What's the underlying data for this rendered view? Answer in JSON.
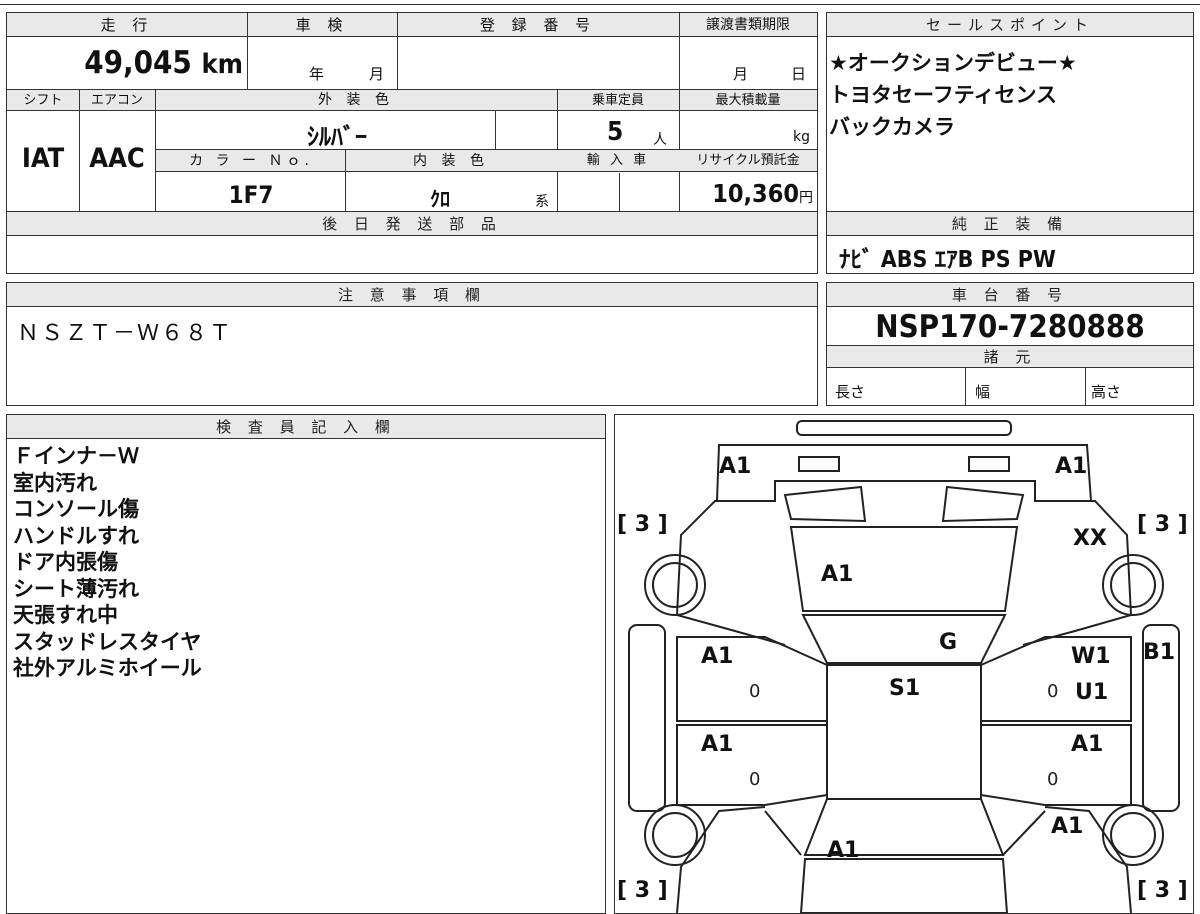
{
  "top_info": {
    "mileage_label": "走 行",
    "mileage_value": "49,045",
    "mileage_unit": "km",
    "shaken_label": "車 検",
    "shaken_year": "年",
    "shaken_month": "月",
    "reg_label": "登 録 番 号",
    "deadline_label": "譲渡書類期限",
    "deadline_month": "月",
    "deadline_day": "日",
    "shift_label": "シフト",
    "shift_value": "IAT",
    "ac_label": "エアコン",
    "ac_value": "AAC",
    "ext_color_label": "外 装 色",
    "ext_color_value": "ｼﾙﾊﾞｰ",
    "capacity_label": "乗車定員",
    "capacity_value": "5",
    "capacity_unit": "人",
    "maxload_label": "最大積載量",
    "maxload_unit": "kg",
    "colorno_label": "カ ラ ー Ｎｏ.",
    "colorno_value": "1F7",
    "int_color_label": "内 装 色",
    "int_color_value": "ｸﾛ",
    "int_color_suffix": "系",
    "import_label": "輸 入 車",
    "recycle_label": "リサイクル預託金",
    "recycle_value": "10,360",
    "recycle_unit": "円"
  },
  "later_parts": {
    "label": "後 日 発 送 部 品"
  },
  "sales_points": {
    "label": "セールスポイント",
    "lines": [
      "★オークションデビュー★",
      "トヨタセーフティセンス",
      "バックカメラ"
    ]
  },
  "equipment": {
    "label": "純 正 装 備",
    "value": "ﾅﾋﾞ ABS ｴｱB PS PW"
  },
  "caution": {
    "label": "注 意 事 項 欄",
    "value": "ＮＳＺＴ－Ｗ６８Ｔ"
  },
  "chassis": {
    "label": "車 台 番 号",
    "value": "NSP170-7280888",
    "specs_label": "諸 元",
    "length_label": "長さ",
    "width_label": "幅",
    "height_label": "高さ"
  },
  "inspector": {
    "label": "検 査 員 記 入 欄",
    "lines": [
      "Ｆインナ－Ｗ",
      "室内汚れ",
      "コンソール傷",
      "ハンドルすれ",
      "ドア内張傷",
      "シート薄汚れ",
      "天張すれ中",
      "スタッドレスタイヤ",
      "社外アルミホイール"
    ]
  },
  "diagram": {
    "tire_marks": [
      "[ 3 ]",
      "[ 3 ]",
      "[ 3 ]",
      "[ 3 ]"
    ],
    "codes": {
      "front_left_corner": "A1",
      "front_right_corner": "A1",
      "hood": "A1",
      "front_right_fender": "XX",
      "windshield": "G",
      "roof": "S1",
      "front_left_door": "A1",
      "front_right_door_1": "W1",
      "front_right_door_2": "U1",
      "right_pillar": "B1",
      "rear_left_door": "A1",
      "rear_right_door": "A1",
      "rear_right_fender": "A1",
      "trunk": "A1"
    },
    "zero_marks": [
      "0",
      "0",
      "0",
      "0"
    ]
  }
}
